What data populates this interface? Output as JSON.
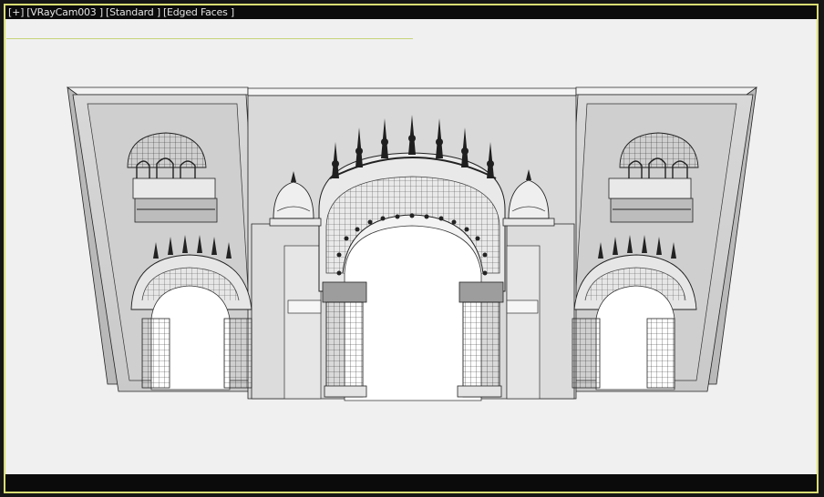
{
  "viewport": {
    "label_plus": "[+]",
    "label_camera": "[VRayCam003 ]",
    "label_shading": "[Standard ]",
    "label_mode": "[Edged Faces ]"
  },
  "colors": {
    "active_border": "#d9dd74",
    "background": "#f0f0f0",
    "wall_face": "#d3d3d3",
    "wall_light": "#ebebeb",
    "wall_dark": "#9a9a9a",
    "edge": "#1e1e1e"
  },
  "scene": {
    "object": "ornate-arched-gateway",
    "icon": "3d-model-wireframe"
  }
}
